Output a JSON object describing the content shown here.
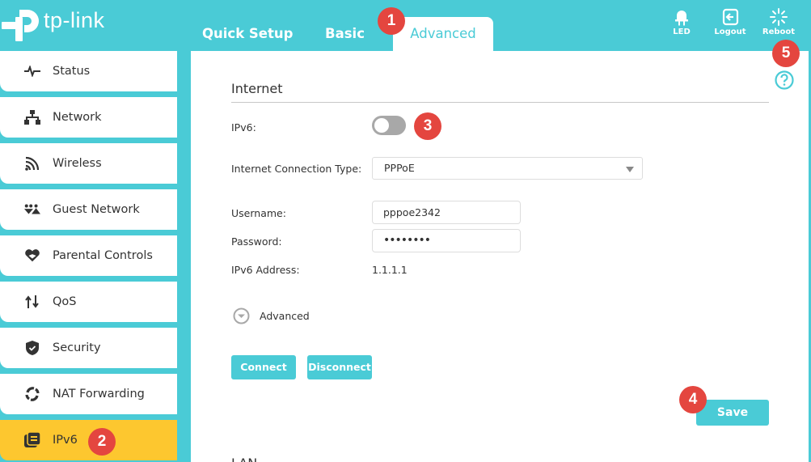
{
  "brand": {
    "name": "tp-link",
    "accent": "#4acbd6",
    "active_item": "#fdc72f",
    "badge_color": "#e4463f"
  },
  "header": {
    "tabs": [
      {
        "label": "Quick Setup",
        "active": false
      },
      {
        "label": "Basic",
        "active": false
      },
      {
        "label": "Advanced",
        "active": true
      }
    ],
    "icons": [
      {
        "icon": "led-icon",
        "label": "LED"
      },
      {
        "icon": "logout-icon",
        "label": "Logout"
      },
      {
        "icon": "reboot-icon",
        "label": "Reboot"
      }
    ]
  },
  "sidebar": {
    "items": [
      {
        "label": "Status",
        "icon": "status-pulse-icon"
      },
      {
        "label": "Network",
        "icon": "network-icon"
      },
      {
        "label": "Wireless",
        "icon": "wireless-icon"
      },
      {
        "label": "Guest Network",
        "icon": "guest-network-icon"
      },
      {
        "label": "Parental Controls",
        "icon": "parental-controls-icon"
      },
      {
        "label": "QoS",
        "icon": "qos-icon"
      },
      {
        "label": "Security",
        "icon": "security-shield-icon"
      },
      {
        "label": "NAT Forwarding",
        "icon": "nat-forwarding-icon"
      },
      {
        "label": "IPv6",
        "icon": "ipv6-icon",
        "active": true
      }
    ]
  },
  "main": {
    "section_title": "Internet",
    "ipv6_label": "IPv6:",
    "ipv6_enabled": false,
    "connection_type_label": "Internet Connection Type:",
    "connection_type_value": "PPPoE",
    "username_label": "Username:",
    "username_value": "pppoe2342",
    "password_label": "Password:",
    "password_value": "••••••••",
    "ipv6_address_label": "IPv6 Address:",
    "ipv6_address_value": "1.1.1.1",
    "advanced_label": "Advanced",
    "connect_label": "Connect",
    "disconnect_label": "Disconnect",
    "save_label": "Save",
    "next_section_title": "LAN"
  },
  "annotations": [
    "1",
    "2",
    "3",
    "4",
    "5"
  ]
}
